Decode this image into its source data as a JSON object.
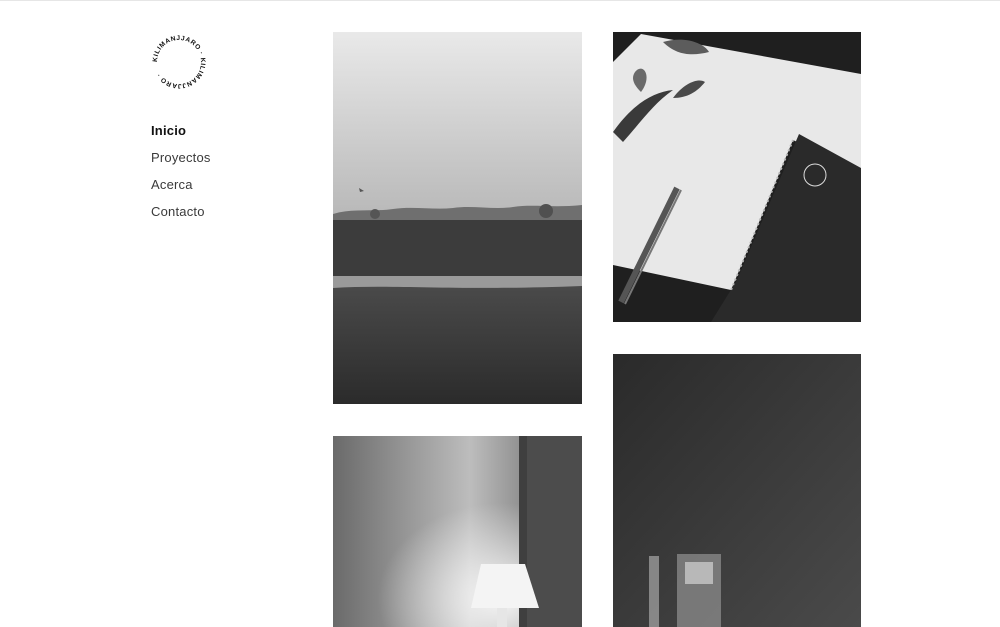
{
  "brand": {
    "logo_text": "KILIMANJJARO · KILIMANJJARO · "
  },
  "nav": {
    "items": [
      {
        "label": "Inicio",
        "active": true
      },
      {
        "label": "Proyectos",
        "active": false
      },
      {
        "label": "Acerca",
        "active": false
      },
      {
        "label": "Contacto",
        "active": false
      }
    ]
  },
  "gallery": {
    "tiles": [
      {
        "subject": "foggy-field-photo"
      },
      {
        "subject": "notebook-desk-photo"
      },
      {
        "subject": "table-lamp-photo"
      },
      {
        "subject": "light-on-wall-photo"
      }
    ]
  },
  "colors": {
    "background": "#ffffff",
    "text": "#222222",
    "active_text": "#111111"
  }
}
